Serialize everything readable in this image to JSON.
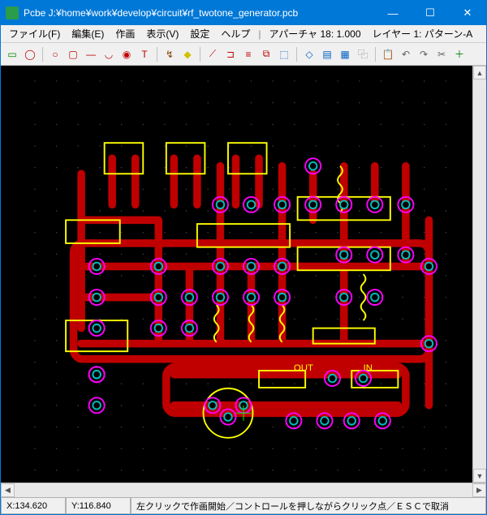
{
  "window": {
    "title": "Pcbe J:¥home¥work¥develop¥circuit¥rf_twotone_generator.pcb",
    "min": "—",
    "max": "☐",
    "close": "✕"
  },
  "menu": {
    "file": "ファイル(F)",
    "edit": "編集(E)",
    "draw": "作画",
    "view": "表示(V)",
    "settings": "設定",
    "help": "ヘルプ",
    "aperture": "アパーチャ 18: 1.000",
    "layer": "レイヤー 1: パターン-A"
  },
  "toolbar": {
    "icons": [
      {
        "name": "select-icon",
        "glyph": "▭",
        "color": "#008000"
      },
      {
        "name": "shape-ring-icon",
        "glyph": "◯",
        "color": "#c00000"
      },
      {
        "name": "shape-circle-icon",
        "glyph": "○",
        "color": "#c00000"
      },
      {
        "name": "shape-rect-icon",
        "glyph": "▢",
        "color": "#c00000"
      },
      {
        "name": "line-icon",
        "glyph": "—",
        "color": "#c00000"
      },
      {
        "name": "arc-icon",
        "glyph": "◡",
        "color": "#c00000"
      },
      {
        "name": "donut-icon",
        "glyph": "◉",
        "color": "#c00000"
      },
      {
        "name": "text-icon",
        "glyph": "T",
        "color": "#c00000"
      },
      {
        "name": "route-icon",
        "glyph": "↯",
        "color": "#804000"
      },
      {
        "name": "erase-icon",
        "glyph": "◆",
        "color": "#d0c000"
      },
      {
        "name": "cut-icon",
        "glyph": "⟋",
        "color": "#c00000"
      },
      {
        "name": "join-icon",
        "glyph": "⊐",
        "color": "#c00000"
      },
      {
        "name": "align-icon",
        "glyph": "≡",
        "color": "#c00000"
      },
      {
        "name": "group-icon",
        "glyph": "⧉",
        "color": "#c00000"
      },
      {
        "name": "marquee-icon",
        "glyph": "⬚",
        "color": "#0060c0"
      },
      {
        "name": "lasso-icon",
        "glyph": "◇",
        "color": "#0060c0"
      },
      {
        "name": "layer-icon",
        "glyph": "▤",
        "color": "#0060c0"
      },
      {
        "name": "grid-icon",
        "glyph": "▦",
        "color": "#0060c0"
      },
      {
        "name": "copy-icon",
        "glyph": "⿻",
        "color": "#606060"
      },
      {
        "name": "paste-icon",
        "glyph": "📋",
        "color": "#606060"
      },
      {
        "name": "undo-icon",
        "glyph": "↶",
        "color": "#606060"
      },
      {
        "name": "redo-icon",
        "glyph": "↷",
        "color": "#606060"
      },
      {
        "name": "cut2-icon",
        "glyph": "✂",
        "color": "#606060"
      },
      {
        "name": "target-icon",
        "glyph": "＋",
        "color": "#008000"
      }
    ]
  },
  "status": {
    "x": "X:134.620",
    "y": "Y:116.840",
    "msg": "左クリックで作画開始／コントロールを押しながらクリック点／ＥＳＣで取消"
  },
  "pcb": {
    "labels": {
      "out": "OUT",
      "in": "IN"
    },
    "colors": {
      "trace": "#c00000",
      "trace2": "#ff0000",
      "outline": "#ffff00",
      "pad_ring": "#ff00ff",
      "pad_center": "#00c0c0",
      "grid": "#404040",
      "bg": "#000000"
    }
  }
}
